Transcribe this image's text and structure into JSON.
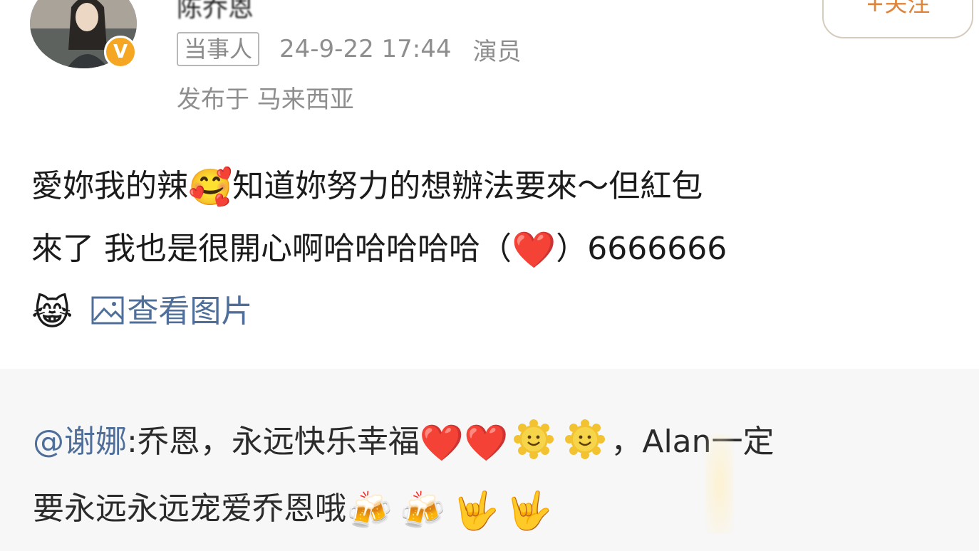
{
  "post": {
    "username": "陈乔恩",
    "follow_label": "+关注",
    "tag": "当事人",
    "timestamp": "24-9-22 17:44",
    "role": "演员",
    "location": "发布于 马来西亚",
    "content": {
      "line1_a": "愛妳我的辣",
      "line1_b": "知道妳努力的想辦法要來～但紅包",
      "line2_a": "來了 我也是很開心啊哈哈哈哈哈（",
      "line2_b": "）6666666",
      "emoji_smiling_hearts": "🥰",
      "emoji_heart": "❤️",
      "emoji_tears_joy": "😹",
      "view_images_label": "查看图片"
    }
  },
  "repost": {
    "mention": "@谢娜",
    "text_a": ":乔恩，永远快乐幸福",
    "text_b": "，Alan一定",
    "line2": "要永远永远宠爱乔恩哦",
    "emoji_heart": "❤️",
    "emoji_beer": "🍻",
    "emoji_rock": "🤟"
  },
  "colors": {
    "link": "#4f6f9a",
    "meta_grey": "#8e8e8e",
    "follow_orange": "#e0843a",
    "badge_orange": "#f5a623",
    "repost_bg": "#f7f7f7"
  }
}
